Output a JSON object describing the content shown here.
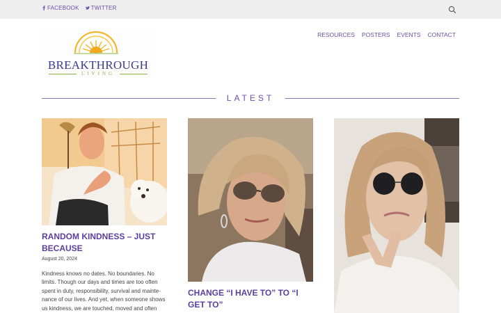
{
  "topbar": {
    "facebook_label": "FACEBOOK",
    "twitter_label": "TWITTER",
    "facebook_icon": "facebook-icon",
    "twitter_icon": "twitter-icon",
    "search_icon": "search-icon"
  },
  "logo": {
    "main_text": "BREAKTHROUGH",
    "sub_text": "LIVING"
  },
  "nav": {
    "items": [
      "RESOURCES",
      "POSTERS",
      "EVENTS",
      "CONTACT"
    ]
  },
  "section": {
    "title": "LATEST"
  },
  "posts": [
    {
      "title": "RANDOM KINDNESS – JUST BECAUSE",
      "date": "August 20, 2024",
      "excerpt": "Kindness knows no dates. No boundaries. No limits. Though our days and times are too often spent in duty, responsibility, survival and mainte-nance of our lives. And yet, when someone shows us kindness, we are touched, moved and often feel undeserving."
    },
    {
      "title": "CHANGE “I HAVE TO” TO “I GET TO”"
    },
    {}
  ],
  "colors": {
    "accent": "#6a4fa3",
    "title": "#5b3fa0",
    "topbar_bg": "#eeeeee"
  }
}
